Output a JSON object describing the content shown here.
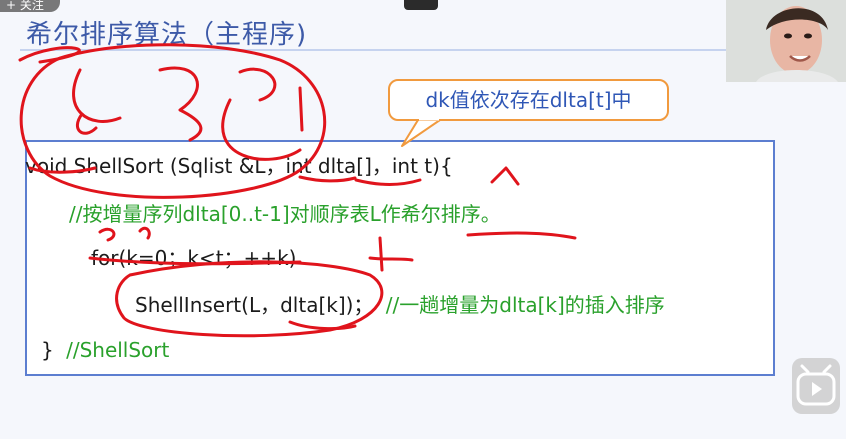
{
  "header": {
    "follow_label": "+ 关注"
  },
  "slide": {
    "title": "希尔排序算法（主程序)",
    "callout": "dk值依次存在dlta[t]中",
    "code": {
      "line1": "void ShellSort (Sqlist &L，int dlta[]，int t){",
      "line2": "//按增量序列dlta[0..t-1]对顺序表L作希尔排序。",
      "line3": "for(k=0；k<t；++k)",
      "line4_code": "ShellInsert(L，dlta[k])；",
      "line4_comment": "//一趟增量为dlta[k]的插入排序",
      "line5_brace": "}",
      "line5_comment": "//ShellSort"
    }
  },
  "colors": {
    "title": "#3d5aa8",
    "comment": "#2aa12c",
    "ink": "#e0141c",
    "callout_border": "#f19a3e",
    "code_border": "#5c7ed0"
  }
}
